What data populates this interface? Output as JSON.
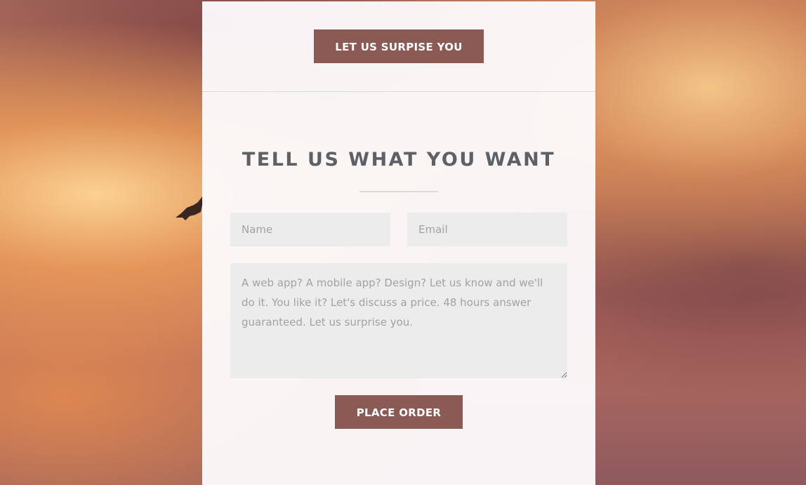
{
  "surprise_section": {
    "button_label": "LET US SURPISE YOU"
  },
  "order_form": {
    "title": "TELL US WHAT YOU WANT",
    "name_placeholder": "Name",
    "email_placeholder": "Email",
    "message_placeholder": "A web app? A mobile app? Design? Let us know and we'll do it. You like it? Let's discuss a price. 48 hours answer guaranteed. Let us surprise you.",
    "submit_label": "PLACE ORDER"
  },
  "colors": {
    "button_background": "#8b5a54",
    "title_color": "#5d6167",
    "field_background": "#ececec"
  },
  "icons": {
    "background_decoration": "bird-silhouette-icon"
  }
}
